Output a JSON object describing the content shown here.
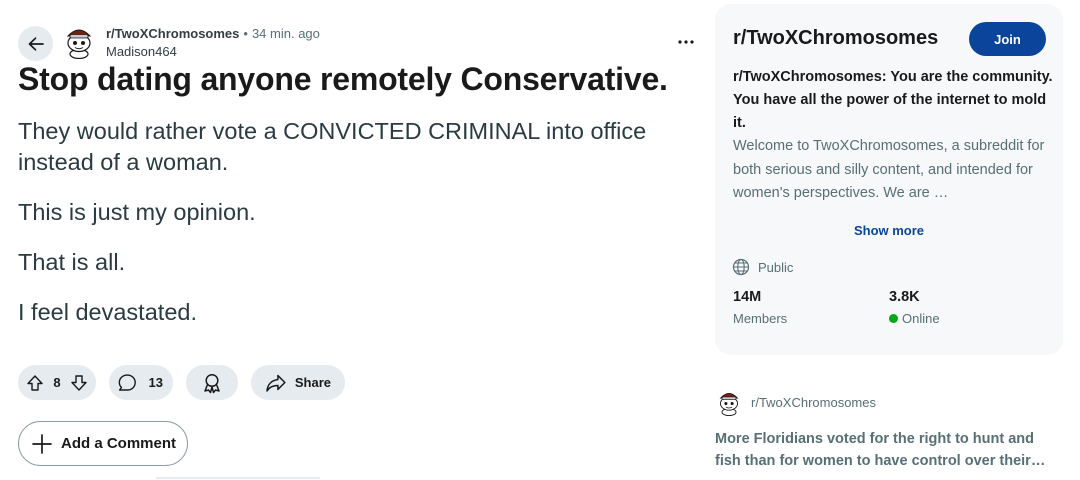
{
  "post": {
    "subreddit": "r/TwoXChromosomes",
    "separator": "•",
    "time": "34 min. ago",
    "author": "Madison464",
    "more_label": "•••",
    "title": "Stop dating anyone remotely Conservative.",
    "body": [
      "They would rather vote a CONVICTED CRIMINAL into office instead of a woman.",
      "This is just my opinion.",
      "That is all.",
      "I feel devastated."
    ],
    "votes": "8",
    "comments": "13",
    "share_label": "Share",
    "add_comment_label": "Add a Comment"
  },
  "sidebar": {
    "title": "r/TwoXChromosomes",
    "join_label": "Join",
    "headline": "r/TwoXChromosomes: You are the community. You have all the power of the internet to mold it.",
    "description": "Welcome to TwoXChromosomes, a subreddit for both serious and silly content, and intended for women's perspectives. We are …",
    "show_more_label": "Show more",
    "visibility": "Public",
    "members_value": "14M",
    "members_label": "Members",
    "online_value": "3.8K",
    "online_label": "Online"
  },
  "related": {
    "subreddit": "r/TwoXChromosomes",
    "title_line1": "More Floridians voted for the right to hunt and",
    "title_line2": "fish than for women to have control over their…"
  },
  "colors": {
    "join_bg": "#0a449b",
    "pill_bg": "#e5ebee",
    "sidebar_bg": "#f6f8f9",
    "online": "#01a816"
  },
  "icons": [
    "back-arrow-icon",
    "snoo-avatar-icon",
    "upvote-icon",
    "downvote-icon",
    "comment-icon",
    "award-icon",
    "share-icon",
    "plus-icon",
    "globe-icon"
  ]
}
